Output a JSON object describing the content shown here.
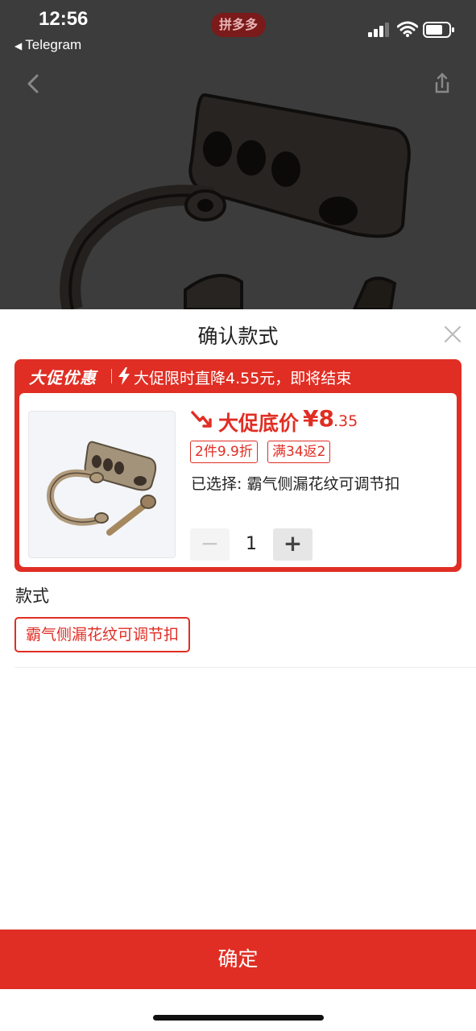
{
  "status_bar": {
    "time": "12:56",
    "back_app": "Telegram",
    "app_badge": "拼多多",
    "back_arrow_icon": "back-triangle-icon",
    "signal_icon": "cellular-signal-icon",
    "wifi_icon": "wifi-icon",
    "battery_icon": "battery-icon"
  },
  "nav": {
    "back_icon": "chevron-left-icon",
    "share_icon": "share-icon"
  },
  "sheet": {
    "title": "确认款式",
    "close_icon": "close-icon",
    "promo": {
      "brand": "大促优惠",
      "bolt_icon": "lightning-icon",
      "message": "大促限时直降4.55元，即将结束",
      "price_label": "大促底价",
      "price_integer": "¥8",
      "price_decimal": ".35",
      "down_arrow_icon": "price-down-arrow-icon",
      "tags": [
        "2件9.9折",
        "满34返2"
      ],
      "selected_text": "已选择: 霸气侧漏花纹可调节扣",
      "quantity": "1",
      "minus_label": "−",
      "plus_label": "+"
    },
    "style_section": {
      "label": "款式",
      "options": [
        "霸气侧漏花纹可调节扣"
      ],
      "selected_index": 0
    },
    "confirm_label": "确定"
  },
  "colors": {
    "accent": "#e02e24",
    "overlay": "#000000"
  }
}
